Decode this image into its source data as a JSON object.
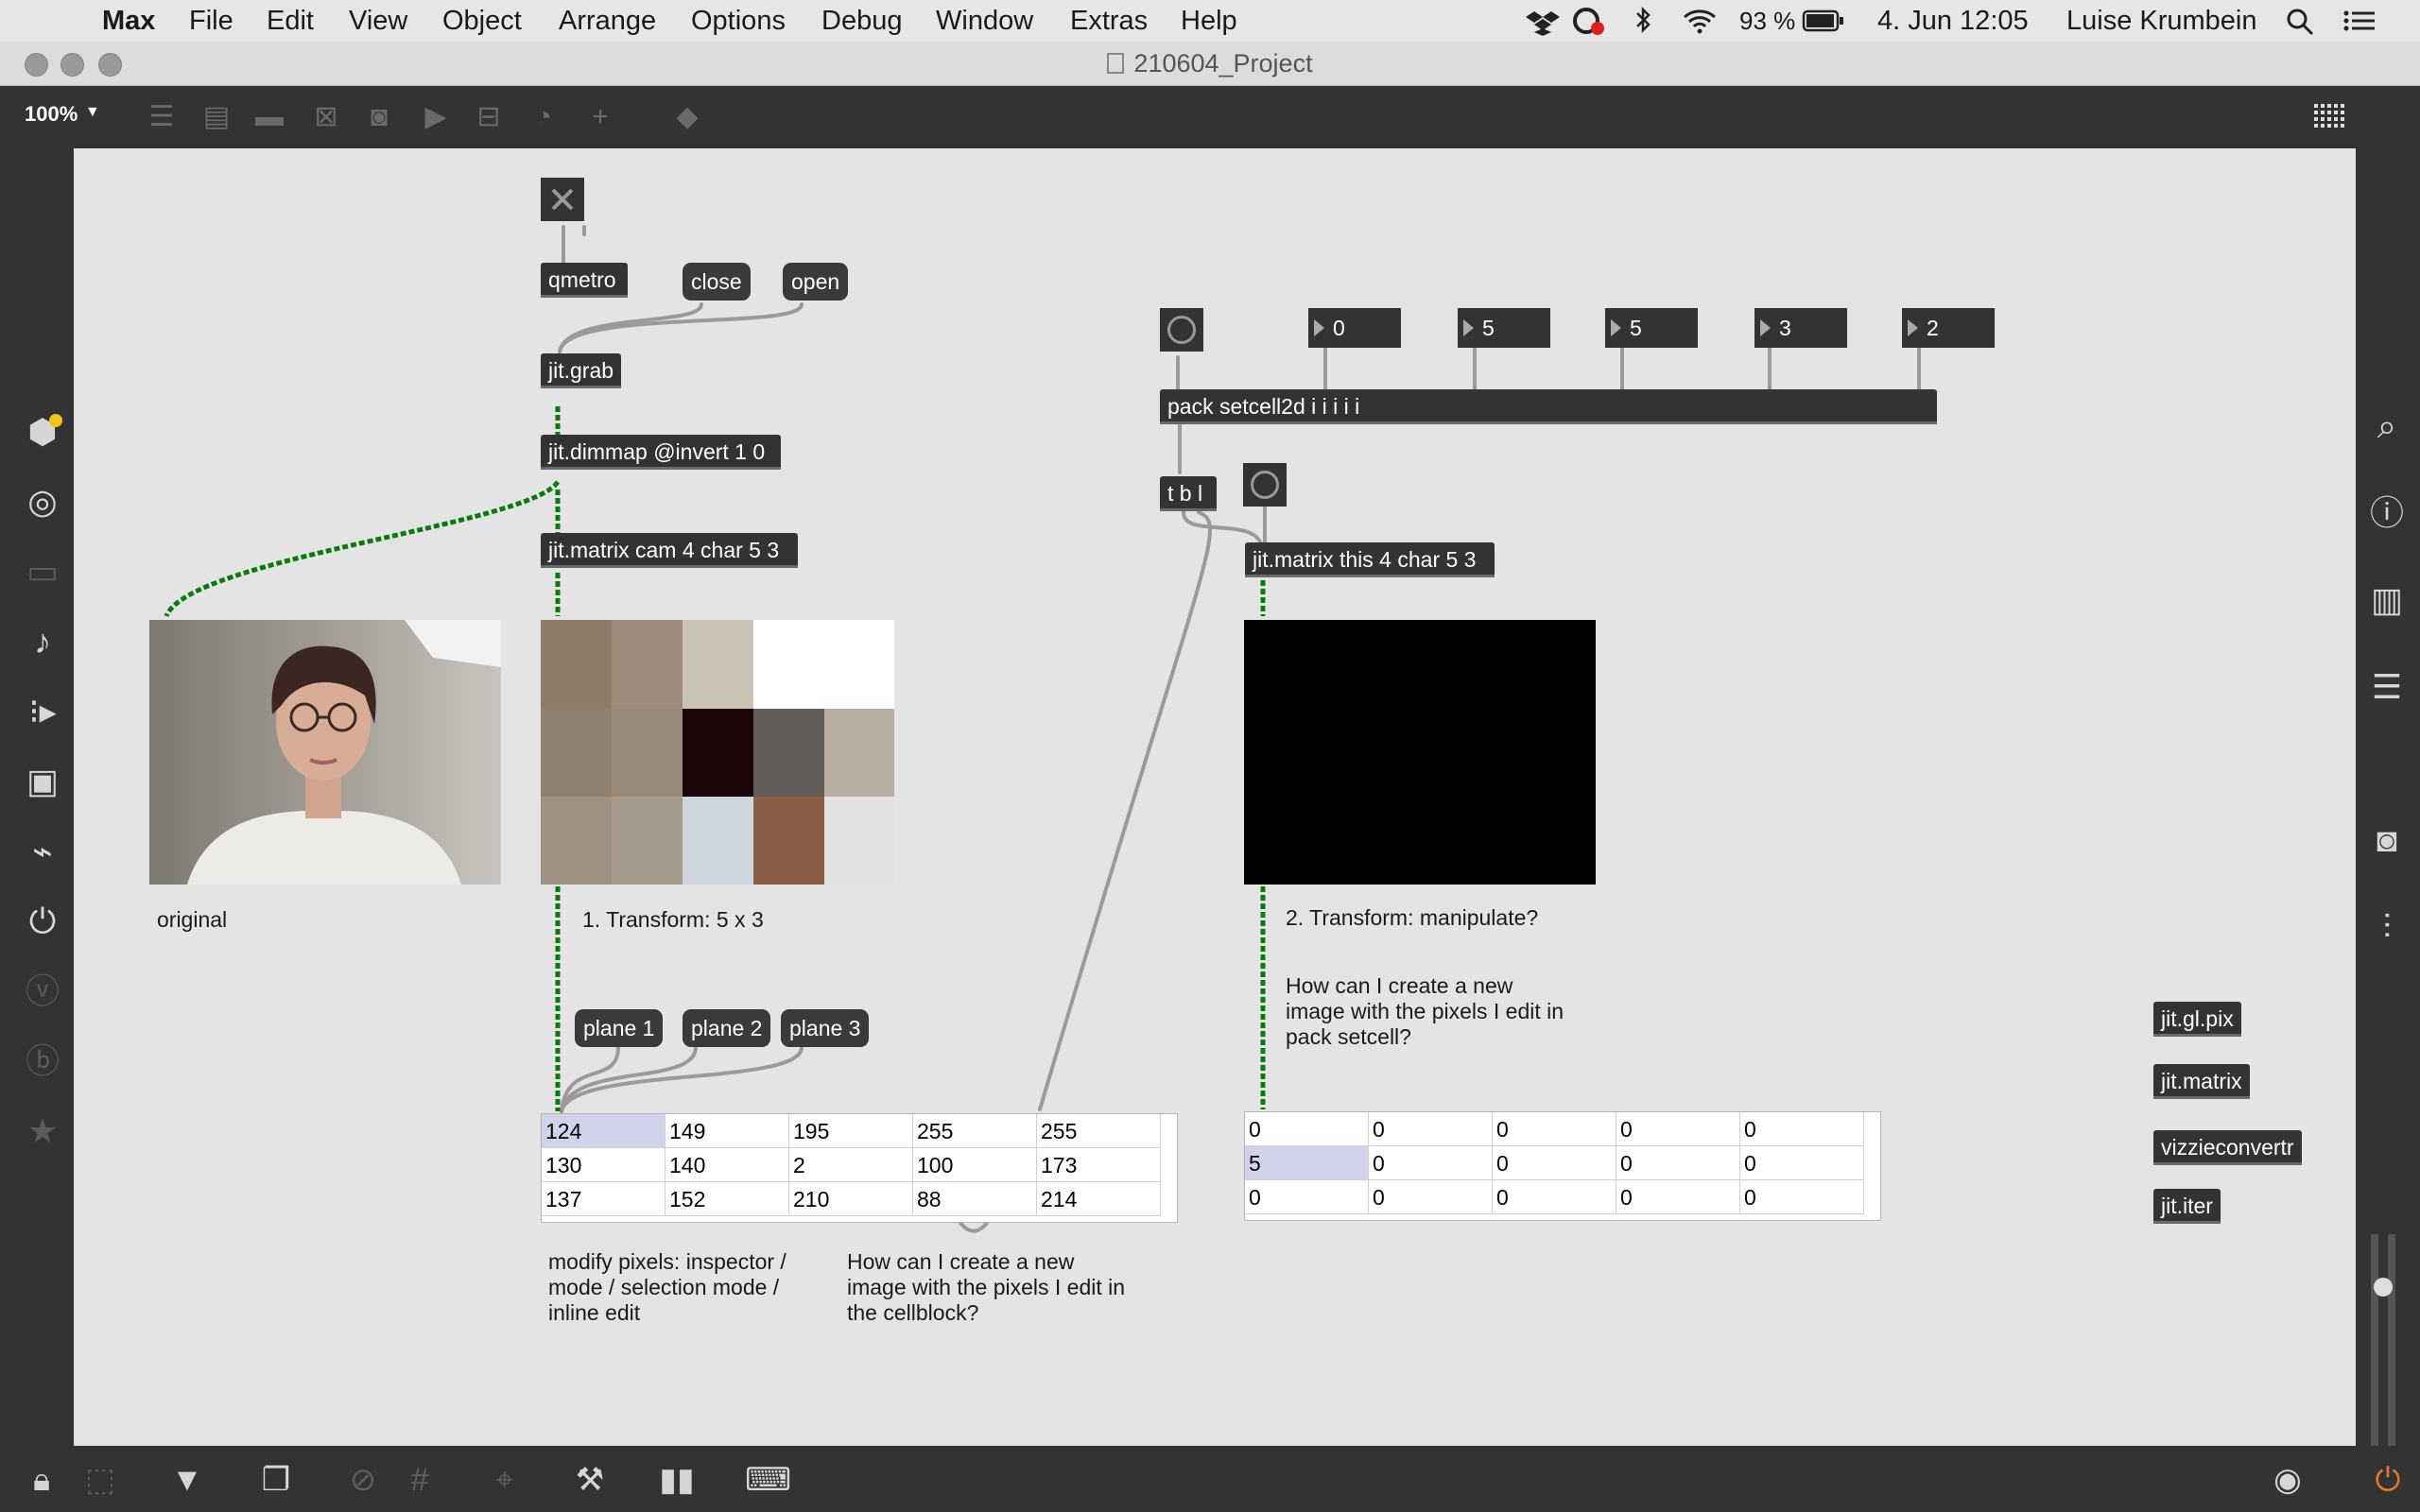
{
  "menubar": {
    "app": "Max",
    "items": [
      "File",
      "Edit",
      "View",
      "Object",
      "Arrange",
      "Options",
      "Debug",
      "Window",
      "Extras",
      "Help"
    ],
    "battery": "93 %",
    "datetime": "4. Jun  12:05",
    "user": "Luise Krumbein"
  },
  "window": {
    "title": "210604_Project",
    "zoom": "100%"
  },
  "objects": {
    "qmetro": "qmetro",
    "close": "close",
    "open": "open",
    "jitgrab": "jit.grab",
    "dimmap": "jit.dimmap @invert 1 0",
    "matrix_cam": "jit.matrix cam 4 char 5 3",
    "pack": "pack setcell2d i i i i i",
    "tbl": "t b l",
    "matrix_this": "jit.matrix this 4 char 5 3",
    "plane1": "plane 1",
    "plane2": "plane 2",
    "plane3": "plane 3",
    "gl_pix": "jit.gl.pix",
    "jit_matrix": "jit.matrix",
    "vizzie": "vizzieconvertr",
    "jit_iter": "jit.iter"
  },
  "numbers": [
    "0",
    "5",
    "5",
    "3",
    "2"
  ],
  "comments": {
    "original": "original",
    "transform1": "1. Transform: 5 x 3",
    "transform2": "2. Transform: manipulate?",
    "question_pack": "How can I create a new image with the pixels I edit in pack setcell?",
    "modify": "modify pixels: inspector / mode / selection mode /  inline edit",
    "question_cellblock": "How can I create a new image with the pixels I edit in the cellblock?"
  },
  "cellblock1": {
    "rows": [
      [
        "124",
        "149",
        "195",
        "255",
        "255"
      ],
      [
        "130",
        "140",
        "2",
        "100",
        "173"
      ],
      [
        "137",
        "152",
        "210",
        "88",
        "214"
      ]
    ],
    "selected": [
      0,
      0
    ]
  },
  "cellblock2": {
    "rows": [
      [
        "0",
        "0",
        "0",
        "0",
        "0"
      ],
      [
        "5",
        "0",
        "0",
        "0",
        "0"
      ],
      [
        "0",
        "0",
        "0",
        "0",
        "0"
      ]
    ],
    "selected": [
      1,
      0
    ]
  },
  "pixel_grid": {
    "colors": [
      [
        "#8e7c6b",
        "#9d8c7d",
        "#c9c4b4",
        "#ffffff",
        "#ffffff"
      ],
      [
        "#8f7f6f",
        "#988878",
        "#1c0609",
        "#605c57",
        "#b8ada0"
      ],
      [
        "#9f9283",
        "#a59a8c",
        "#cdd5de",
        "#8b5f45",
        "#e2e2e2"
      ]
    ]
  },
  "icons": {
    "left_sidebar": [
      "package-icon",
      "target-icon",
      "video-icon",
      "note-icon",
      "playlist-icon",
      "image-icon",
      "paperclip-icon",
      "plug-icon",
      "vimeo-icon",
      "beatport-icon",
      "star-icon"
    ],
    "right_sidebar": [
      "search-icon",
      "info-icon",
      "columns-icon",
      "list-icon",
      "snapshot-icon",
      "mixer-icon"
    ]
  }
}
